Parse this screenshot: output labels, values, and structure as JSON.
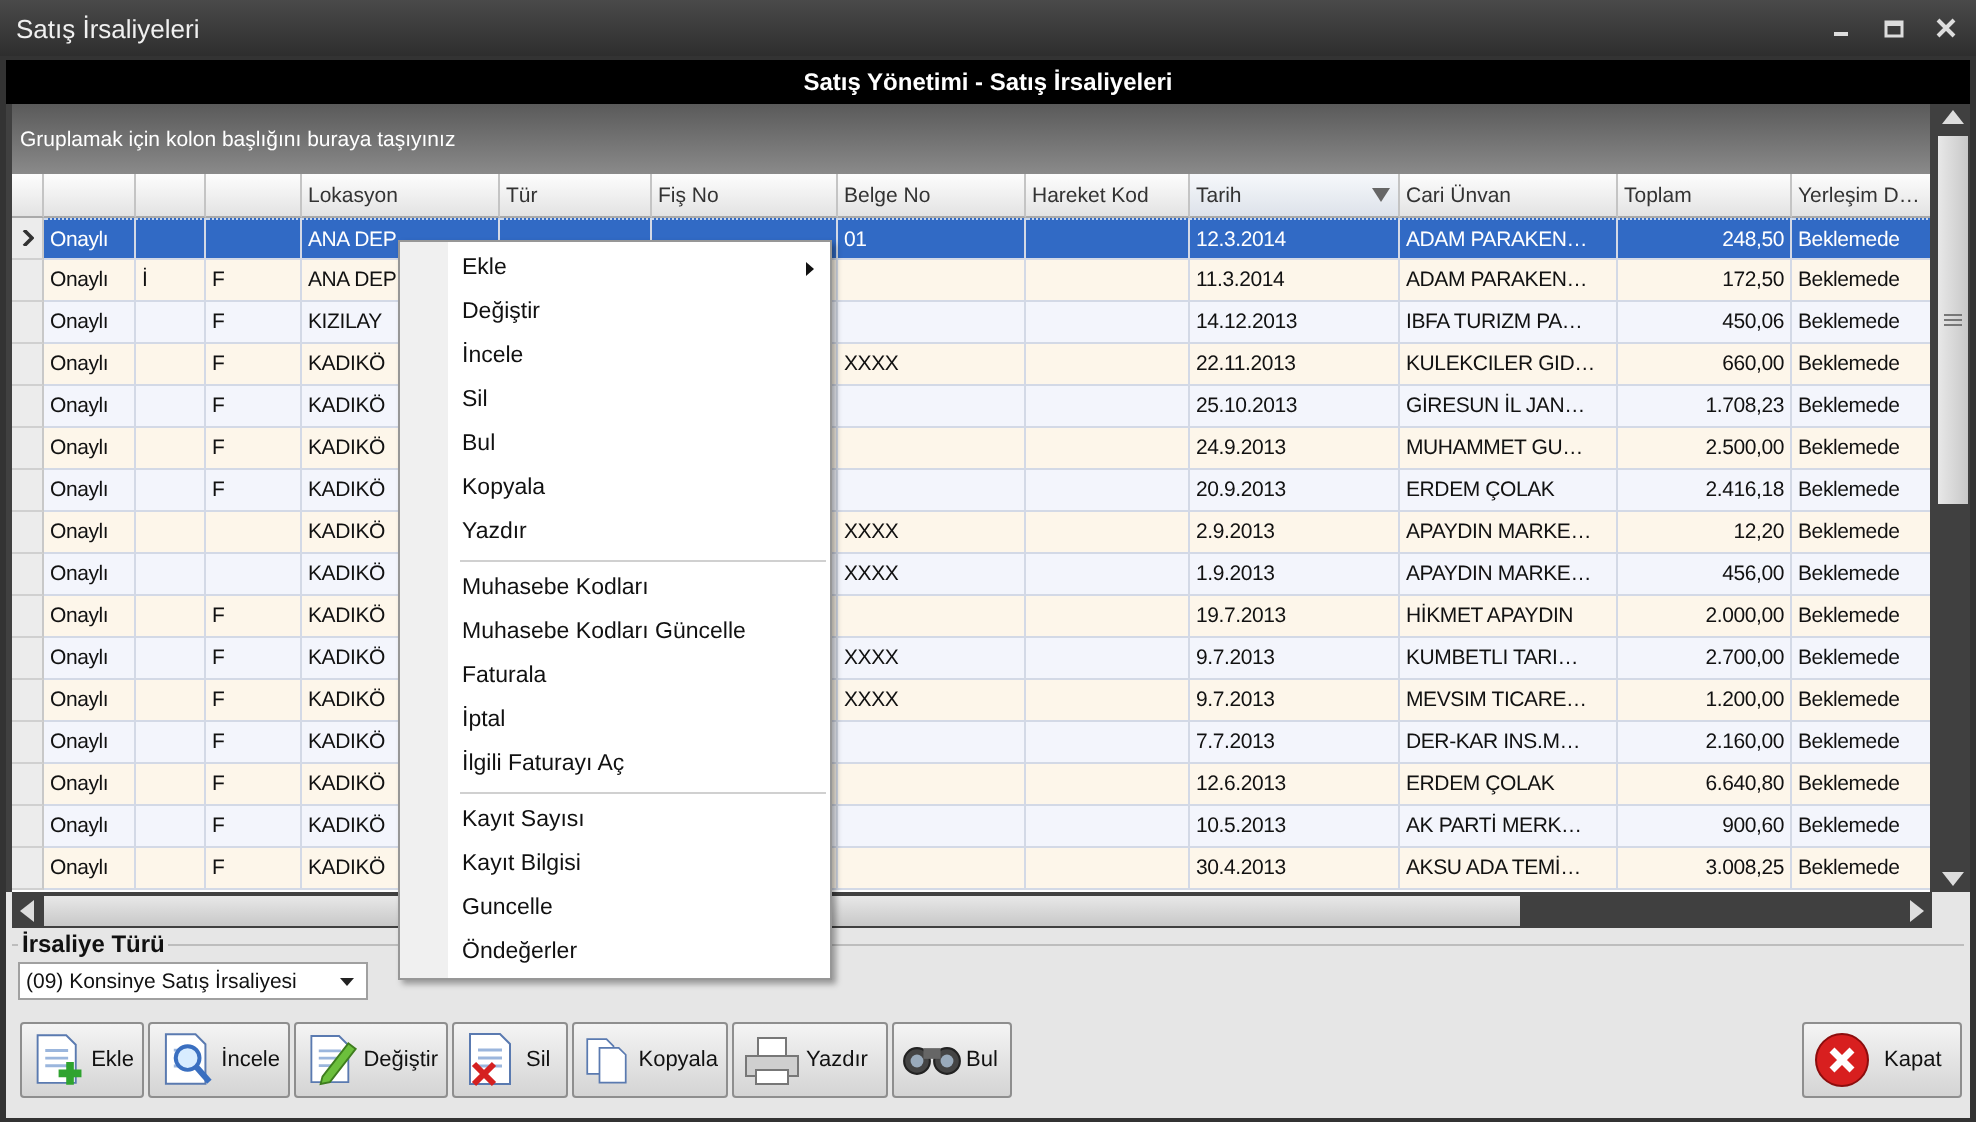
{
  "window": {
    "title": "Satış İrsaliyeleri"
  },
  "header": {
    "title": "Satış Yönetimi - Satış İrsaliyeleri"
  },
  "group_panel": {
    "hint": "Gruplamak için kolon başlığını buraya taşıyınız"
  },
  "grid": {
    "columns": [
      {
        "label": "Lokasyon",
        "sorted": false
      },
      {
        "label": "Tür",
        "sorted": false
      },
      {
        "label": "Fiş No",
        "sorted": false
      },
      {
        "label": "Belge No",
        "sorted": false
      },
      {
        "label": "Hareket Kod",
        "sorted": false
      },
      {
        "label": "Tarih",
        "sorted": true
      },
      {
        "label": "Cari Ünvan",
        "sorted": false
      },
      {
        "label": "Toplam",
        "sorted": false
      },
      {
        "label": "Yerleşim D…",
        "sorted": false
      }
    ],
    "rows": [
      {
        "selected": true,
        "cells": {
          "column_1": "Onaylı",
          "lokasyon": "ANA DEP",
          "belge_no": "01",
          "tarih": "12.3.2014",
          "cari_unvan": "ADAM PARAKEN…",
          "toplam": "248,50",
          "yerlesim_d": "Beklemede"
        }
      },
      {
        "selected": false,
        "cells": {
          "column_1": "Onaylı",
          "column_2": "İ",
          "column_3": "F",
          "lokasyon": "ANA DEP",
          "tarih": "11.3.2014",
          "cari_unvan": "ADAM PARAKEN…",
          "toplam": "172,50",
          "yerlesim_d": "Beklemede"
        }
      },
      {
        "selected": false,
        "cells": {
          "column_1": "Onaylı",
          "column_3": "F",
          "lokasyon": "KIZILAY",
          "tarih": "14.12.2013",
          "cari_unvan": "IBFA TURIZM PA…",
          "toplam": "450,06",
          "yerlesim_d": "Beklemede"
        }
      },
      {
        "selected": false,
        "cells": {
          "column_1": "Onaylı",
          "column_3": "F",
          "lokasyon": "KADIKÖ",
          "belge_no": "XXXX",
          "tarih": "22.11.2013",
          "cari_unvan": "KULEKCILER GID…",
          "toplam": "660,00",
          "yerlesim_d": "Beklemede"
        }
      },
      {
        "selected": false,
        "cells": {
          "column_1": "Onaylı",
          "column_3": "F",
          "lokasyon": "KADIKÖ",
          "tarih": "25.10.2013",
          "cari_unvan": "GİRESUN İL JAN…",
          "toplam": "1.708,23",
          "yerlesim_d": "Beklemede"
        }
      },
      {
        "selected": false,
        "cells": {
          "column_1": "Onaylı",
          "column_3": "F",
          "lokasyon": "KADIKÖ",
          "tarih": "24.9.2013",
          "cari_unvan": "MUHAMMET GU…",
          "toplam": "2.500,00",
          "yerlesim_d": "Beklemede"
        }
      },
      {
        "selected": false,
        "cells": {
          "column_1": "Onaylı",
          "column_3": "F",
          "lokasyon": "KADIKÖ",
          "tarih": "20.9.2013",
          "cari_unvan": "ERDEM ÇOLAK",
          "toplam": "2.416,18",
          "yerlesim_d": "Beklemede"
        }
      },
      {
        "selected": false,
        "cells": {
          "column_1": "Onaylı",
          "lokasyon": "KADIKÖ",
          "belge_no": "XXXX",
          "tarih": "2.9.2013",
          "cari_unvan": "APAYDIN MARKE…",
          "toplam": "12,20",
          "yerlesim_d": "Beklemede"
        }
      },
      {
        "selected": false,
        "cells": {
          "column_1": "Onaylı",
          "lokasyon": "KADIKÖ",
          "belge_no": "XXXX",
          "tarih": "1.9.2013",
          "cari_unvan": "APAYDIN MARKE…",
          "toplam": "456,00",
          "yerlesim_d": "Beklemede"
        }
      },
      {
        "selected": false,
        "cells": {
          "column_1": "Onaylı",
          "column_3": "F",
          "lokasyon": "KADIKÖ",
          "tarih": "19.7.2013",
          "cari_unvan": "HİKMET APAYDIN",
          "toplam": "2.000,00",
          "yerlesim_d": "Beklemede"
        }
      },
      {
        "selected": false,
        "cells": {
          "column_1": "Onaylı",
          "column_3": "F",
          "lokasyon": "KADIKÖ",
          "belge_no": "XXXX",
          "tarih": "9.7.2013",
          "cari_unvan": "KUMBETLI TARI…",
          "toplam": "2.700,00",
          "yerlesim_d": "Beklemede"
        }
      },
      {
        "selected": false,
        "cells": {
          "column_1": "Onaylı",
          "column_3": "F",
          "lokasyon": "KADIKÖ",
          "belge_no": "XXXX",
          "tarih": "9.7.2013",
          "cari_unvan": "MEVSIM TICARE…",
          "toplam": "1.200,00",
          "yerlesim_d": "Beklemede"
        }
      },
      {
        "selected": false,
        "cells": {
          "column_1": "Onaylı",
          "column_3": "F",
          "lokasyon": "KADIKÖ",
          "tarih": "7.7.2013",
          "cari_unvan": "DER-KAR INS.M…",
          "toplam": "2.160,00",
          "yerlesim_d": "Beklemede"
        }
      },
      {
        "selected": false,
        "cells": {
          "column_1": "Onaylı",
          "column_3": "F",
          "lokasyon": "KADIKÖ",
          "tarih": "12.6.2013",
          "cari_unvan": "ERDEM ÇOLAK",
          "toplam": "6.640,80",
          "yerlesim_d": "Beklemede"
        }
      },
      {
        "selected": false,
        "cells": {
          "column_1": "Onaylı",
          "column_3": "F",
          "lokasyon": "KADIKÖ",
          "tarih": "10.5.2013",
          "cari_unvan": "AK PARTİ MERK…",
          "toplam": "900,60",
          "yerlesim_d": "Beklemede"
        }
      },
      {
        "selected": false,
        "cells": {
          "column_1": "Onaylı",
          "column_3": "F",
          "lokasyon": "KADIKÖ",
          "tarih": "30.4.2013",
          "cari_unvan": "AKSU ADA TEMİ…",
          "toplam": "3.008,25",
          "yerlesim_d": "Beklemede"
        }
      }
    ]
  },
  "context_menu": {
    "items": [
      {
        "kind": "item",
        "label": "Ekle",
        "submenu": true
      },
      {
        "kind": "item",
        "label": "Değiştir",
        "submenu": false
      },
      {
        "kind": "item",
        "label": "İncele",
        "submenu": false
      },
      {
        "kind": "item",
        "label": "Sil",
        "submenu": false
      },
      {
        "kind": "item",
        "label": "Bul",
        "submenu": false
      },
      {
        "kind": "item",
        "label": "Kopyala",
        "submenu": false
      },
      {
        "kind": "item",
        "label": "Yazdır",
        "submenu": false
      },
      {
        "kind": "separator"
      },
      {
        "kind": "item",
        "label": "Muhasebe Kodları",
        "submenu": false
      },
      {
        "kind": "item",
        "label": "Muhasebe Kodları Güncelle",
        "submenu": false
      },
      {
        "kind": "item",
        "label": "Faturala",
        "submenu": false
      },
      {
        "kind": "item",
        "label": "İptal",
        "submenu": false
      },
      {
        "kind": "item",
        "label": "İlgili Faturayı Aç",
        "submenu": false
      },
      {
        "kind": "separator"
      },
      {
        "kind": "item",
        "label": "Kayıt Sayısı",
        "submenu": false
      },
      {
        "kind": "item",
        "label": "Kayıt Bilgisi",
        "submenu": false
      },
      {
        "kind": "item",
        "label": "Guncelle",
        "submenu": false
      },
      {
        "kind": "item",
        "label": "Öndeğerler",
        "submenu": false
      }
    ]
  },
  "filter": {
    "legend": "İrsaliye Türü",
    "value": "(09) Konsinye Satış İrsaliyesi"
  },
  "toolbar": {
    "buttons": [
      {
        "label": "Ekle"
      },
      {
        "label": "İncele"
      },
      {
        "label": "Değiştir"
      },
      {
        "label": "Sil"
      },
      {
        "label": "Kopyala"
      },
      {
        "label": "Yazdır"
      },
      {
        "label": "Bul"
      }
    ],
    "close_button": {
      "label": "Kapat"
    }
  }
}
